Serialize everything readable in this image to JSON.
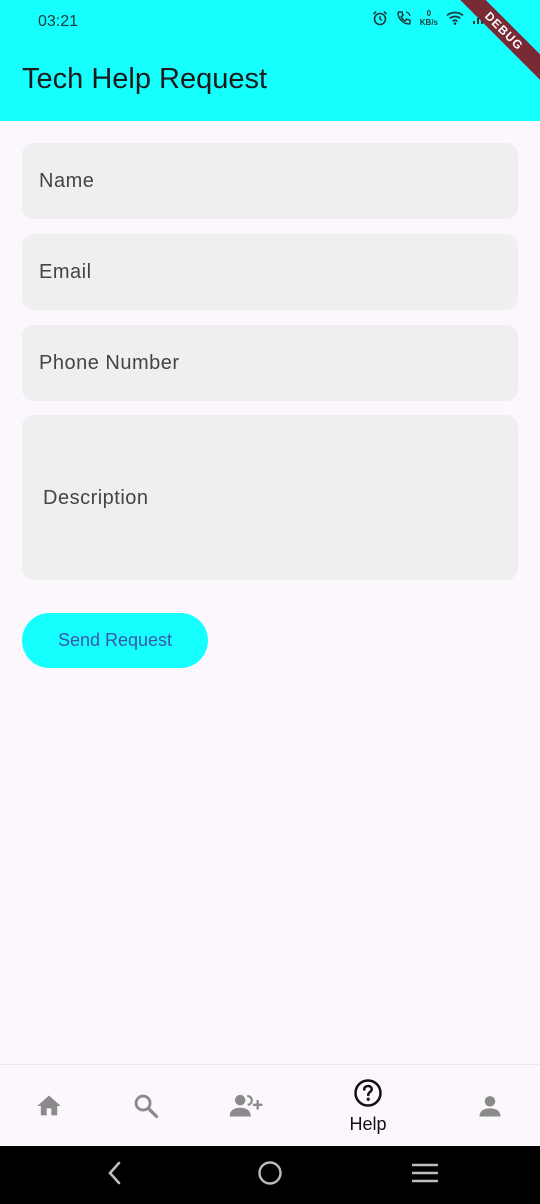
{
  "status_bar": {
    "time": "03:21",
    "net_speed_value": "0",
    "net_speed_unit": "KB/s",
    "icons": [
      "alarm-icon",
      "call-icon",
      "wifi-icon",
      "signal-icon",
      "battery-icon"
    ]
  },
  "debug_banner": "DEBUG",
  "app_bar": {
    "title": "Tech Help Request"
  },
  "form": {
    "name_placeholder": "Name",
    "email_placeholder": "Email",
    "phone_placeholder": "Phone Number",
    "description_placeholder": "Description",
    "send_label": "Send Request"
  },
  "bottom_nav": {
    "items": [
      {
        "icon": "home-icon",
        "label": "",
        "selected": false
      },
      {
        "icon": "search-icon",
        "label": "",
        "selected": false
      },
      {
        "icon": "add-user-icon",
        "label": "",
        "selected": false
      },
      {
        "icon": "help-icon",
        "label": "Help",
        "selected": true
      },
      {
        "icon": "person-icon",
        "label": "",
        "selected": false
      }
    ]
  },
  "system_nav": [
    "back-icon",
    "home-circle-icon",
    "recents-icon"
  ],
  "colors": {
    "accent": "#16FFFF",
    "background": "#FCF6FD",
    "field_fill": "#EFEFEF",
    "button_text": "#3A58A8",
    "nav_icon_inactive": "#8A8A8A"
  }
}
